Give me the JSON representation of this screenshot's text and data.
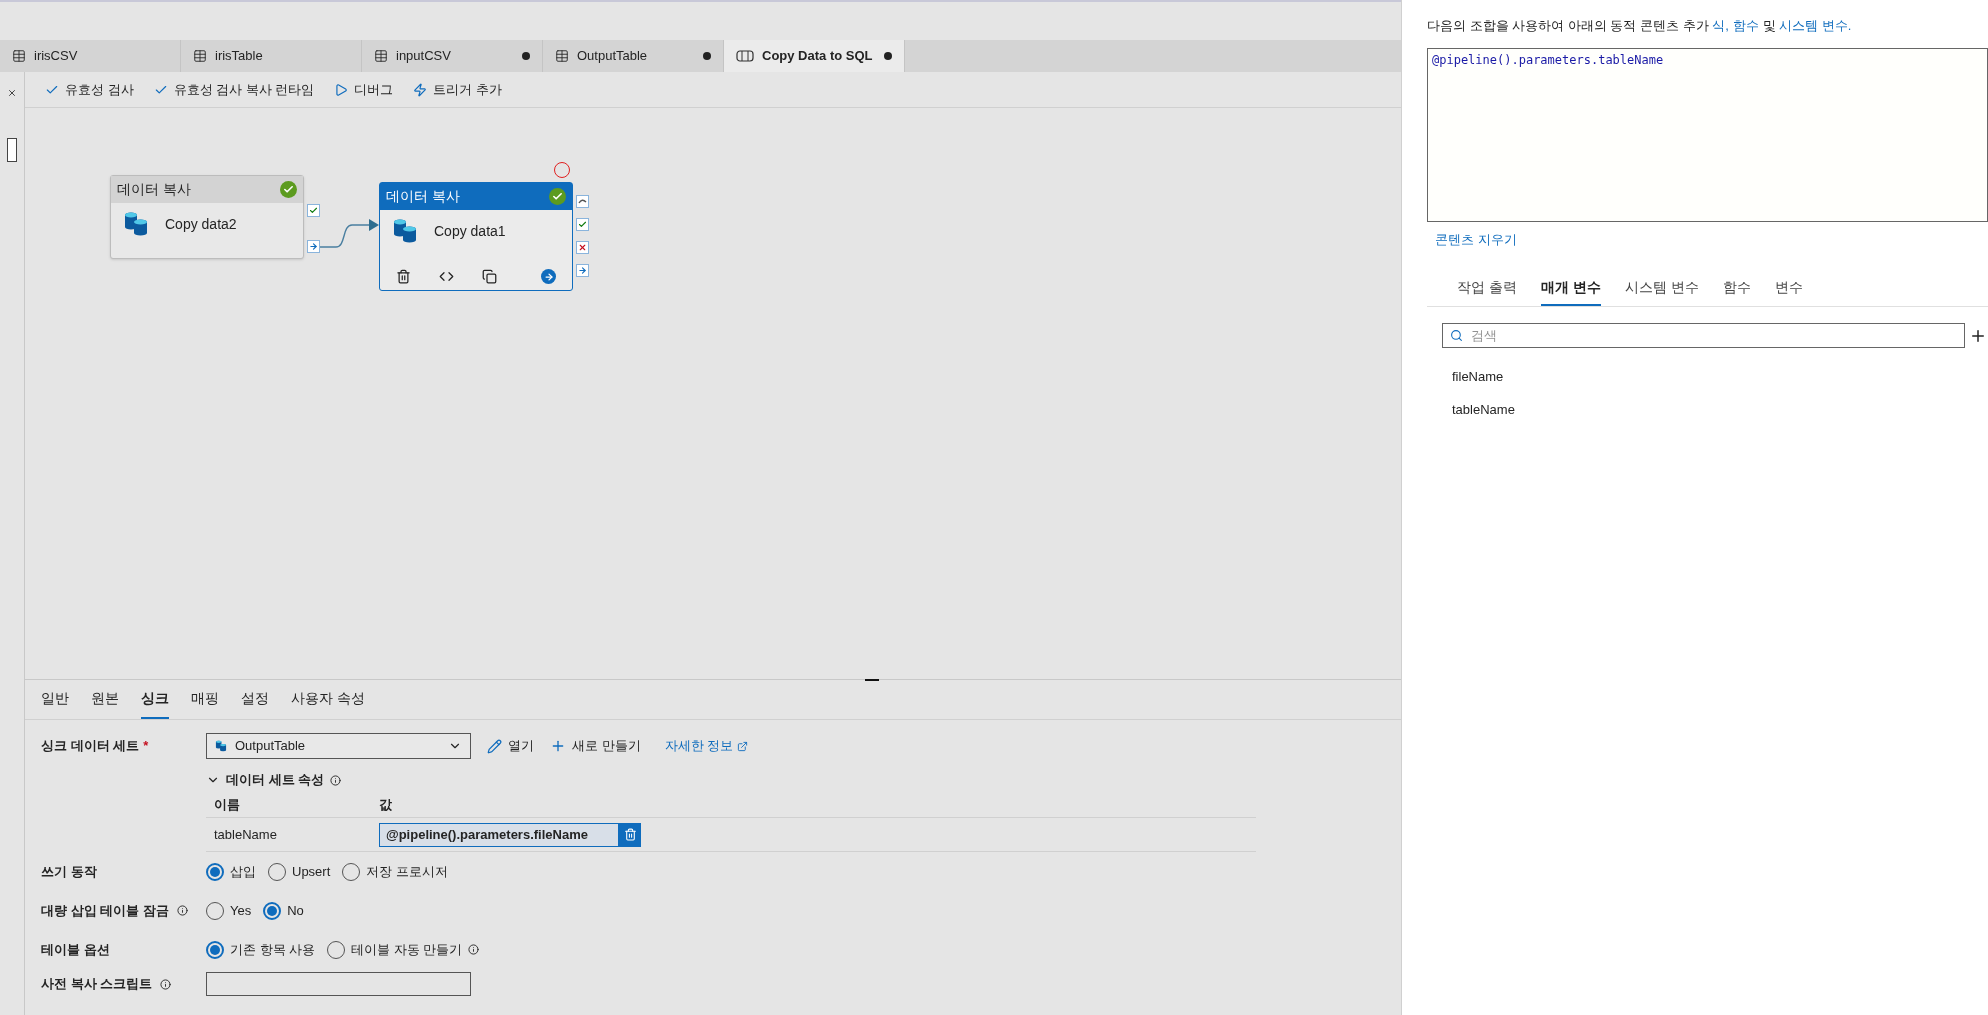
{
  "tabs": [
    {
      "label": "irisCSV",
      "kind": "dataset",
      "unsaved": false,
      "selected": false
    },
    {
      "label": "irisTable",
      "kind": "dataset",
      "unsaved": false,
      "selected": false
    },
    {
      "label": "inputCSV",
      "kind": "dataset",
      "unsaved": true,
      "selected": false
    },
    {
      "label": "OutputTable",
      "kind": "dataset",
      "unsaved": true,
      "selected": false
    },
    {
      "label": "Copy Data to SQL",
      "kind": "pipeline",
      "unsaved": true,
      "selected": true
    }
  ],
  "toolbar": [
    {
      "label": "유효성 검사",
      "kind": "check"
    },
    {
      "label": "유효성 검사 복사 런타임",
      "kind": "check"
    },
    {
      "label": "디버그",
      "kind": "play"
    },
    {
      "label": "트리거 추가",
      "kind": "trigger"
    }
  ],
  "canvas": {
    "activities": [
      {
        "type": "데이터 복사",
        "name": "Copy data2",
        "selected": false,
        "validated": true,
        "ports": [
          {
            "kind": "success"
          },
          {
            "kind": "completion"
          }
        ]
      },
      {
        "type": "데이터 복사",
        "name": "Copy data1",
        "selected": true,
        "validated": true,
        "ports": [
          {
            "kind": "skip"
          },
          {
            "kind": "success"
          },
          {
            "kind": "failure"
          },
          {
            "kind": "completion"
          }
        ]
      }
    ]
  },
  "properties": {
    "tabs": [
      {
        "label": "일반",
        "selected": false
      },
      {
        "label": "원본",
        "selected": false
      },
      {
        "label": "싱크",
        "selected": true
      },
      {
        "label": "매핑",
        "selected": false
      },
      {
        "label": "설정",
        "selected": false
      },
      {
        "label": "사용자 속성",
        "selected": false
      }
    ],
    "sink_dataset": {
      "label": "싱크 데이터 세트",
      "required_mark": "*",
      "value": "OutputTable",
      "open": "열기",
      "new": "새로 만들기",
      "learn_more": "자세한 정보"
    },
    "dataset_properties": {
      "title": "데이터 세트 속성",
      "expanded": true,
      "columns": [
        "이름",
        "값"
      ],
      "rows": [
        {
          "name": "tableName",
          "value": "@pipeline().parameters.fileName"
        }
      ]
    },
    "options": [
      {
        "label": "쓰기 동작",
        "info": false,
        "choices": [
          {
            "label": "삽입",
            "selected": true,
            "info": false
          },
          {
            "label": "Upsert",
            "selected": false,
            "info": false
          },
          {
            "label": "저장 프로시저",
            "selected": false,
            "info": false
          }
        ]
      },
      {
        "label": "대량 삽입 테이블 잠금",
        "info": true,
        "choices": [
          {
            "label": "Yes",
            "selected": false,
            "info": false
          },
          {
            "label": "No",
            "selected": true,
            "info": false
          }
        ]
      },
      {
        "label": "테이블 옵션",
        "info": false,
        "choices": [
          {
            "label": "기존 항목 사용",
            "selected": true,
            "info": false
          },
          {
            "label": "테이블 자동 만들기",
            "selected": false,
            "info": true
          }
        ]
      }
    ],
    "pre_copy_script": {
      "label": "사전 복사 스크립트",
      "info": true
    }
  },
  "dynamic_content": {
    "description": [
      {
        "kind": "text",
        "text": "다음의 조합을 사용하여 아래의 동적 콘텐츠 추가 "
      },
      {
        "kind": "link",
        "text": "식"
      },
      {
        "kind": "link",
        "text": ","
      },
      {
        "kind": "link",
        "text": "함수"
      },
      {
        "kind": "text",
        "text": " 및 "
      },
      {
        "kind": "link",
        "text": "시스템 변수"
      },
      {
        "kind": "link",
        "text": "."
      }
    ],
    "expression": "@pipeline().parameters.tableName",
    "clear": "콘텐츠 지우기",
    "tabs": [
      {
        "label": "작업 출력",
        "selected": false
      },
      {
        "label": "매개 변수",
        "selected": true
      },
      {
        "label": "시스템 변수",
        "selected": false
      },
      {
        "label": "함수",
        "selected": false
      },
      {
        "label": "변수",
        "selected": false
      }
    ],
    "search": {
      "placeholder": "검색"
    },
    "items": [
      "fileName",
      "tableName"
    ]
  }
}
